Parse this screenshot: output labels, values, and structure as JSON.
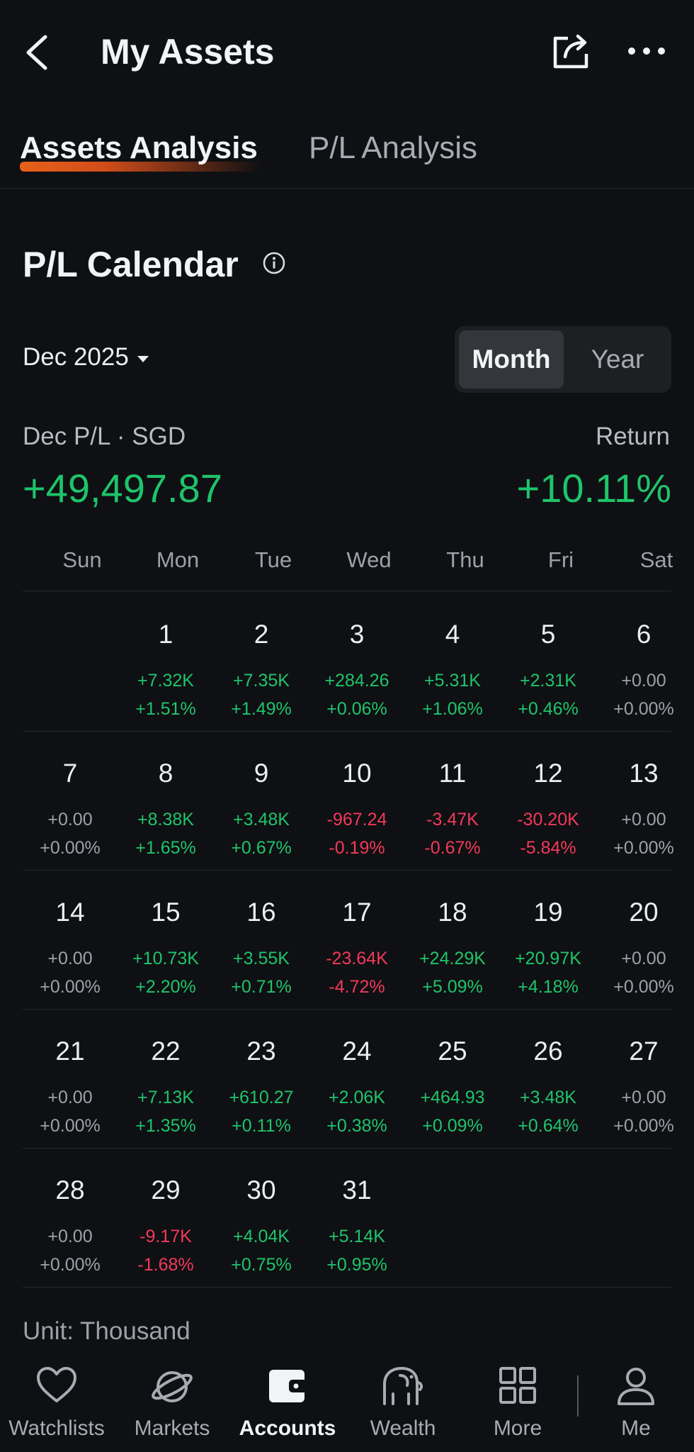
{
  "header": {
    "title": "My Assets"
  },
  "tabs": [
    {
      "label": "Assets Analysis",
      "active": true
    },
    {
      "label": "P/L Analysis",
      "active": false
    }
  ],
  "calendar": {
    "section_title": "P/L Calendar",
    "month_label": "Dec 2025",
    "toggle": {
      "month": "Month",
      "year": "Year",
      "selected": "Month"
    },
    "pl_label": "Dec P/L · SGD",
    "pl_value": "+49,497.87",
    "return_label": "Return",
    "return_value": "+10.11%",
    "weekdays": [
      "Sun",
      "Mon",
      "Tue",
      "Wed",
      "Thu",
      "Fri",
      "Sat"
    ],
    "weeks": [
      [
        null,
        {
          "day": "1",
          "value": "+7.32K",
          "pct": "+1.51%",
          "sign": "pos"
        },
        {
          "day": "2",
          "value": "+7.35K",
          "pct": "+1.49%",
          "sign": "pos"
        },
        {
          "day": "3",
          "value": "+284.26",
          "pct": "+0.06%",
          "sign": "pos"
        },
        {
          "day": "4",
          "value": "+5.31K",
          "pct": "+1.06%",
          "sign": "pos"
        },
        {
          "day": "5",
          "value": "+2.31K",
          "pct": "+0.46%",
          "sign": "pos"
        },
        {
          "day": "6",
          "value": "+0.00",
          "pct": "+0.00%",
          "sign": "zero"
        }
      ],
      [
        {
          "day": "7",
          "value": "+0.00",
          "pct": "+0.00%",
          "sign": "zero"
        },
        {
          "day": "8",
          "value": "+8.38K",
          "pct": "+1.65%",
          "sign": "pos"
        },
        {
          "day": "9",
          "value": "+3.48K",
          "pct": "+0.67%",
          "sign": "pos"
        },
        {
          "day": "10",
          "value": "-967.24",
          "pct": "-0.19%",
          "sign": "neg"
        },
        {
          "day": "11",
          "value": "-3.47K",
          "pct": "-0.67%",
          "sign": "neg"
        },
        {
          "day": "12",
          "value": "-30.20K",
          "pct": "-5.84%",
          "sign": "neg"
        },
        {
          "day": "13",
          "value": "+0.00",
          "pct": "+0.00%",
          "sign": "zero"
        }
      ],
      [
        {
          "day": "14",
          "value": "+0.00",
          "pct": "+0.00%",
          "sign": "zero"
        },
        {
          "day": "15",
          "value": "+10.73K",
          "pct": "+2.20%",
          "sign": "pos"
        },
        {
          "day": "16",
          "value": "+3.55K",
          "pct": "+0.71%",
          "sign": "pos"
        },
        {
          "day": "17",
          "value": "-23.64K",
          "pct": "-4.72%",
          "sign": "neg"
        },
        {
          "day": "18",
          "value": "+24.29K",
          "pct": "+5.09%",
          "sign": "pos"
        },
        {
          "day": "19",
          "value": "+20.97K",
          "pct": "+4.18%",
          "sign": "pos"
        },
        {
          "day": "20",
          "value": "+0.00",
          "pct": "+0.00%",
          "sign": "zero"
        }
      ],
      [
        {
          "day": "21",
          "value": "+0.00",
          "pct": "+0.00%",
          "sign": "zero"
        },
        {
          "day": "22",
          "value": "+7.13K",
          "pct": "+1.35%",
          "sign": "pos"
        },
        {
          "day": "23",
          "value": "+610.27",
          "pct": "+0.11%",
          "sign": "pos"
        },
        {
          "day": "24",
          "value": "+2.06K",
          "pct": "+0.38%",
          "sign": "pos"
        },
        {
          "day": "25",
          "value": "+464.93",
          "pct": "+0.09%",
          "sign": "pos"
        },
        {
          "day": "26",
          "value": "+3.48K",
          "pct": "+0.64%",
          "sign": "pos"
        },
        {
          "day": "27",
          "value": "+0.00",
          "pct": "+0.00%",
          "sign": "zero"
        }
      ],
      [
        {
          "day": "28",
          "value": "+0.00",
          "pct": "+0.00%",
          "sign": "zero"
        },
        {
          "day": "29",
          "value": "-9.17K",
          "pct": "-1.68%",
          "sign": "neg"
        },
        {
          "day": "30",
          "value": "+4.04K",
          "pct": "+0.75%",
          "sign": "pos"
        },
        {
          "day": "31",
          "value": "+5.14K",
          "pct": "+0.95%",
          "sign": "pos"
        },
        null,
        null,
        null
      ]
    ],
    "unit_note": "Unit: Thousand"
  },
  "bottom_nav": [
    {
      "label": "Watchlists",
      "icon": "heart-icon",
      "active": false
    },
    {
      "label": "Markets",
      "icon": "planet-icon",
      "active": false
    },
    {
      "label": "Accounts",
      "icon": "wallet-icon",
      "active": true
    },
    {
      "label": "Wealth",
      "icon": "elephant-icon",
      "active": false
    },
    {
      "label": "More",
      "icon": "grid-icon",
      "active": false
    },
    {
      "label": "Me",
      "icon": "person-icon",
      "active": false
    }
  ],
  "colors": {
    "background": "#0f1013",
    "positive": "#1ec46b",
    "negative": "#f2395a",
    "accent": "#ff6a1a"
  }
}
